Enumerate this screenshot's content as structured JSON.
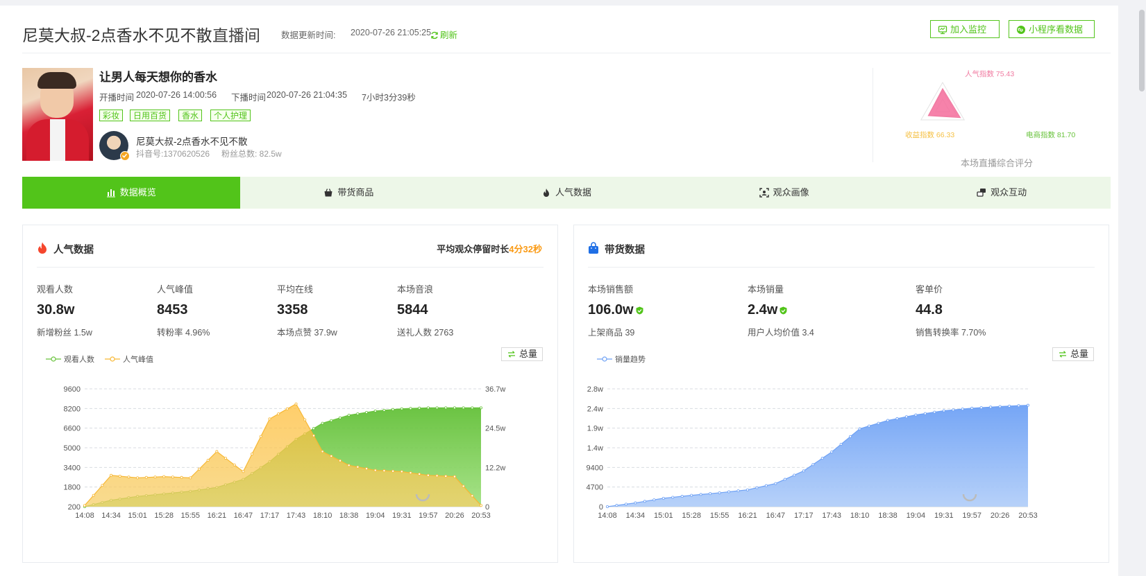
{
  "header": {
    "anchor_title": "尼莫大叔-2点香水不见不散",
    "room_suffix": "直播间",
    "update_label": "数据更新时间:",
    "update_time": "2020-07-26 21:05:25",
    "refresh_label": "刷新",
    "monitor_label": "加入监控",
    "miniapp_label": "小程序看数据"
  },
  "info": {
    "room_name": "让男人每天想你的香水",
    "start_label": "开播时间",
    "start_time": "2020-07-26 14:00:56",
    "end_label": "下播时间",
    "end_time": "2020-07-26 21:04:35",
    "duration": "7小时3分39秒",
    "tags": [
      "彩妆",
      "日用百货",
      "香水",
      "个人护理"
    ],
    "anchor_name": "尼莫大叔-2点香水不见不散",
    "douyin_id": "抖音号:1370620526",
    "fans": "粉丝总数: 82.5w"
  },
  "score": {
    "popularity": "人气指数 75.43",
    "income": "收益指数 66.33",
    "ecommerce": "电商指数 81.70",
    "caption": "本场直播综合评分",
    "values": {
      "popularity": 75.43,
      "income": 66.33,
      "ecommerce": 81.7
    }
  },
  "tabs": [
    {
      "label": "数据概览",
      "icon": "bar-chart-icon"
    },
    {
      "label": "带货商品",
      "icon": "basket-icon"
    },
    {
      "label": "人气数据",
      "icon": "flame-icon"
    },
    {
      "label": "观众画像",
      "icon": "scan-icon"
    },
    {
      "label": "观众互动",
      "icon": "chat-icon"
    }
  ],
  "popularity_panel": {
    "title": "人气数据",
    "dwell_label": "平均观众停留时长",
    "dwell_value": "4分32秒",
    "stats": [
      {
        "label": "观看人数",
        "value": "30.8w",
        "sub": "新增粉丝 1.5w"
      },
      {
        "label": "人气峰值",
        "value": "8453",
        "sub": "转粉率 4.96%"
      },
      {
        "label": "平均在线",
        "value": "3358",
        "sub": "本场点赞 37.9w"
      },
      {
        "label": "本场音浪",
        "value": "5844",
        "sub": "送礼人数 2763"
      }
    ],
    "total_label": "总量"
  },
  "sales_panel": {
    "title": "带货数据",
    "stats": [
      {
        "label": "本场销售额",
        "value": "106.0w",
        "sub": "上架商品 39"
      },
      {
        "label": "本场销量",
        "value": "2.4w",
        "sub": "用户人均价值 3.4"
      },
      {
        "label": "客单价",
        "value": "44.8",
        "sub": "销售转换率 7.70%"
      }
    ],
    "total_label": "总量"
  },
  "colors": {
    "accent": "#52c41a",
    "tab_bg": "#edf7e8",
    "popularity_series": "#f7b733",
    "viewers_series": "#67c23a",
    "sales_series": "#6ea1f5",
    "dwell_highlight": "#fa9a14"
  },
  "chart_data": [
    {
      "type": "area",
      "x": [
        "14:08",
        "14:34",
        "15:01",
        "15:28",
        "15:55",
        "16:21",
        "16:47",
        "17:17",
        "17:43",
        "18:10",
        "18:38",
        "19:04",
        "19:31",
        "19:57",
        "20:26",
        "20:53"
      ],
      "legend": "top-left",
      "grid": true,
      "y_left_ticks": [
        "200",
        "1800",
        "3400",
        "5000",
        "6600",
        "8200",
        "9600"
      ],
      "y_right_ticks": [
        "0",
        "12.2w",
        "24.5w",
        "36.7w"
      ],
      "ylim_left": [
        200,
        9600
      ],
      "ylim_right": [
        0,
        367000
      ],
      "series": [
        {
          "name": "观看人数",
          "axis": "right",
          "values": [
            0,
            20000,
            32000,
            40000,
            48000,
            60000,
            85000,
            140000,
            210000,
            260000,
            285000,
            298000,
            305000,
            308000,
            308000,
            308000
          ]
        },
        {
          "name": "人气峰值",
          "axis": "left",
          "values": [
            300,
            2700,
            2500,
            2600,
            2500,
            4600,
            3000,
            7200,
            8400,
            4600,
            3500,
            3100,
            3000,
            2700,
            2600,
            300
          ]
        }
      ]
    },
    {
      "type": "area",
      "x": [
        "14:08",
        "14:34",
        "15:01",
        "15:28",
        "15:55",
        "16:21",
        "16:47",
        "17:17",
        "17:43",
        "18:10",
        "18:38",
        "19:04",
        "19:31",
        "19:57",
        "20:26",
        "20:53"
      ],
      "legend": "top-left",
      "grid": true,
      "y_ticks": [
        "0",
        "4700",
        "9400",
        "1.4w",
        "1.9w",
        "2.4w",
        "2.8w"
      ],
      "ylim": [
        0,
        28000
      ],
      "series": [
        {
          "name": "销量趋势",
          "values": [
            0,
            900,
            2000,
            2700,
            3300,
            4000,
            5500,
            8500,
            13000,
            18500,
            20500,
            21800,
            22800,
            23400,
            23800,
            24100
          ]
        }
      ]
    }
  ]
}
